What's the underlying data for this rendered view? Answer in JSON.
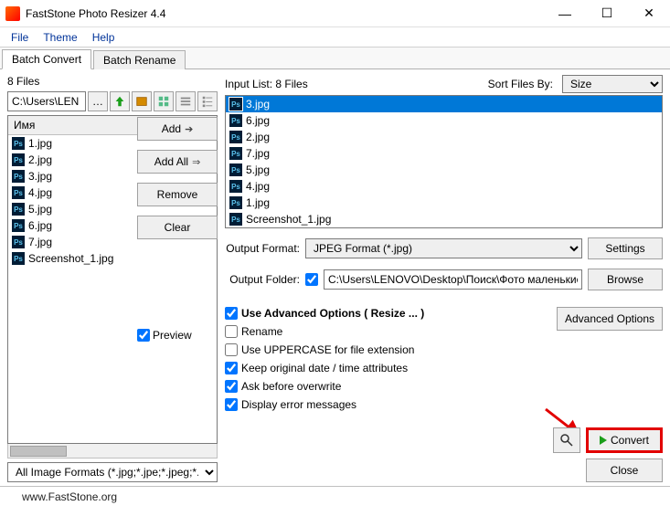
{
  "titlebar": {
    "title": "FastStone Photo Resizer 4.4"
  },
  "menu": {
    "file": "File",
    "theme": "Theme",
    "help": "Help"
  },
  "tabs": {
    "convert": "Batch Convert",
    "rename": "Batch Rename"
  },
  "left": {
    "files_count_label": "8 Files",
    "path": "C:\\Users\\LEN",
    "col_header": "Имя",
    "files": [
      "1.jpg",
      "2.jpg",
      "3.jpg",
      "4.jpg",
      "5.jpg",
      "6.jpg",
      "7.jpg",
      "Screenshot_1.jpg"
    ],
    "filter": "All Image Formats (*.jpg;*.jpe;*.jpeg;*."
  },
  "center_buttons": {
    "add": "Add",
    "add_all": "Add All",
    "remove": "Remove",
    "clear": "Clear"
  },
  "right": {
    "input_list_label": "Input List:  8 Files",
    "sort_label": "Sort Files By:",
    "sort_value": "Size",
    "input_files": [
      "3.jpg",
      "6.jpg",
      "2.jpg",
      "7.jpg",
      "5.jpg",
      "4.jpg",
      "1.jpg",
      "Screenshot_1.jpg"
    ],
    "selected_index": 0,
    "output_format_label": "Output Format:",
    "output_format_value": "JPEG Format (*.jpg)",
    "settings_btn": "Settings",
    "output_folder_label": "Output Folder:",
    "output_folder_value": "C:\\Users\\LENOVO\\Desktop\\Поиск\\Фото маленькие",
    "browse_btn": "Browse",
    "adv_opts_label": "Use Advanced Options ( Resize ... )",
    "adv_btn": "Advanced Options",
    "rename_label": "Rename",
    "uppercase_label": "Use UPPERCASE for file extension",
    "keep_date_label": "Keep original date / time attributes",
    "ask_overwrite_label": "Ask before overwrite",
    "display_errors_label": "Display error messages",
    "preview_label": "Preview",
    "convert_btn": "Convert",
    "close_btn": "Close"
  },
  "footer": {
    "url": "www.FastStone.org"
  }
}
